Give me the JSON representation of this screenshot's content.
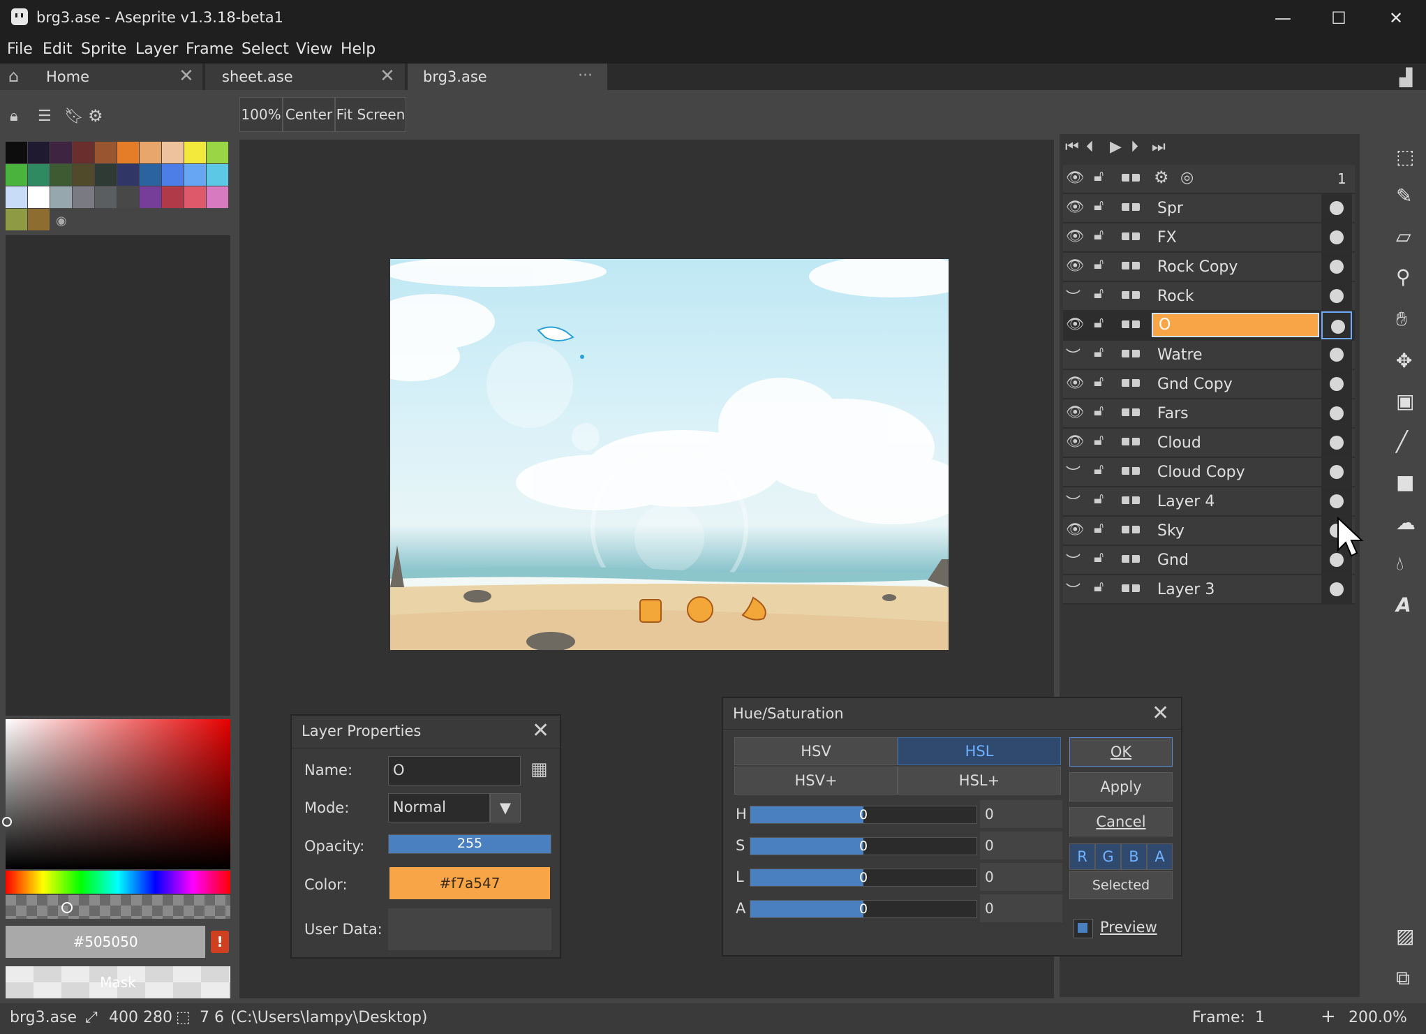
{
  "window": {
    "title": "brg3.ase - Aseprite v1.3.18-beta1",
    "minimize": "—",
    "maximize": "☐",
    "close": "✕"
  },
  "menu": [
    "File",
    "Edit",
    "Sprite",
    "Layer",
    "Frame",
    "Select",
    "View",
    "Help"
  ],
  "tabs": [
    {
      "label": "Home",
      "close": "✕"
    },
    {
      "label": "sheet.ase",
      "close": "✕"
    },
    {
      "label": "brg3.ase",
      "close": "···"
    }
  ],
  "zoom_buttons": {
    "zoom": "100%",
    "center": "Center",
    "fit": "Fit Screen"
  },
  "palette": {
    "colors": [
      "#0d0d0d",
      "#1f1a30",
      "#3e2440",
      "#6a2f2c",
      "#99552f",
      "#e57d28",
      "#e8a66d",
      "#efc29e",
      "#f3e83c",
      "#9ad544",
      "#4ab33e",
      "#2f8a62",
      "#3d5a33",
      "#504a2a",
      "#2f3a35",
      "#303766",
      "#2b63a0",
      "#4d7ee8",
      "#66a6f2",
      "#5cc8e6",
      "#c8dcf8",
      "#ffffff",
      "#97a7ae",
      "#7a7a82",
      "#5b5e60",
      "#484848",
      "#763d99",
      "#b03a48",
      "#de5a6a",
      "#d87ac0",
      "#8e9a44",
      "#8d6d30"
    ]
  },
  "color_picker": {
    "hex": "#505050",
    "warning": "!",
    "mask": "Mask"
  },
  "timeline": {
    "frame_number": "1",
    "layers": [
      {
        "name": "Spr",
        "visible": true
      },
      {
        "name": "FX",
        "visible": true
      },
      {
        "name": "Rock Copy",
        "visible": true
      },
      {
        "name": "Rock",
        "visible": false
      },
      {
        "name": "O",
        "visible": true,
        "selected": true
      },
      {
        "name": "Watre",
        "visible": false
      },
      {
        "name": "Gnd Copy",
        "visible": true
      },
      {
        "name": "Fars",
        "visible": true
      },
      {
        "name": "Cloud",
        "visible": true
      },
      {
        "name": "Cloud Copy",
        "visible": false
      },
      {
        "name": "Layer 4",
        "visible": false
      },
      {
        "name": "Sky",
        "visible": true
      },
      {
        "name": "Gnd",
        "visible": false
      },
      {
        "name": "Layer 3",
        "visible": false
      }
    ]
  },
  "layer_properties": {
    "title": "Layer Properties",
    "name_label": "Name:",
    "name_value": "O",
    "mode_label": "Mode:",
    "mode_value": "Normal",
    "opacity_label": "Opacity:",
    "opacity_value": "255",
    "color_label": "Color:",
    "color_value": "#f7a547",
    "userdata_label": "User Data:"
  },
  "hue_saturation": {
    "title": "Hue/Saturation",
    "modes": [
      "HSV",
      "HSL",
      "HSV+",
      "HSL+"
    ],
    "active_mode": "HSL",
    "sliders": [
      {
        "label": "H",
        "value": "0",
        "entry": "0"
      },
      {
        "label": "S",
        "value": "0",
        "entry": "0"
      },
      {
        "label": "L",
        "value": "0",
        "entry": "0"
      },
      {
        "label": "A",
        "value": "0",
        "entry": "0"
      }
    ],
    "ok": "OK",
    "apply": "Apply",
    "cancel": "Cancel",
    "channels": [
      "R",
      "G",
      "B",
      "A"
    ],
    "target": "Selected",
    "preview_label": "Preview",
    "preview_checked": true
  },
  "status": {
    "file": "brg3.ase",
    "size": "400 280",
    "position": "7 6",
    "path": "(C:\\Users\\lampy\\Desktop)",
    "frame_label": "Frame:",
    "frame_value": "1",
    "add": "+",
    "zoom": "200.0%"
  }
}
